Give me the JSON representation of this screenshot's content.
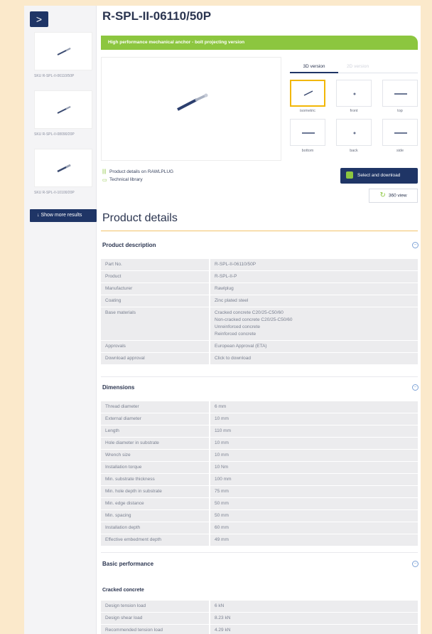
{
  "sidebar": {
    "nav_arrow": ">",
    "items": [
      {
        "sku": "SKU R-SPL-II-06110/50P"
      },
      {
        "sku": "SKU R-SPL-II-08090/20P"
      },
      {
        "sku": "SKU R-SPL-II-10100/20P"
      }
    ],
    "more_label": "Show more results"
  },
  "product": {
    "title": "R-SPL-II-06110/50P",
    "banner": "High performance mechanical anchor - bolt projecting version"
  },
  "viewer": {
    "tabs": [
      "3D version",
      "2D version"
    ],
    "views": [
      {
        "label": "isometric"
      },
      {
        "label": "front"
      },
      {
        "label": "top"
      },
      {
        "label": "bottom"
      },
      {
        "label": "back"
      },
      {
        "label": "side"
      }
    ]
  },
  "links": {
    "details": "Product details on RAWLPLUG",
    "library": "Technical library"
  },
  "actions": {
    "download": "Select and download",
    "view360": "360 view"
  },
  "details_title": "Product details",
  "sections": {
    "description": {
      "title": "Product description",
      "rows": [
        {
          "k": "Part No.",
          "v": "R-SPL-II-06110/50P"
        },
        {
          "k": "Product",
          "v": "R-SPL-II-P"
        },
        {
          "k": "Manufacturer",
          "v": "Rawlplug"
        },
        {
          "k": "Coating",
          "v": "Zinc plated steel"
        },
        {
          "k": "Base materials",
          "v": "Cracked concrete C20/25-C50/60\nNon-cracked concrete C20/25-C50/60\nUnreinforced concrete\nReinforced concrete"
        },
        {
          "k": "Approvals",
          "v": "European Approval (ETA)"
        },
        {
          "k": "Download approval",
          "v": "Click to download"
        }
      ]
    },
    "dimensions": {
      "title": "Dimensions",
      "rows": [
        {
          "k": "Thread diameter",
          "v": "6 mm"
        },
        {
          "k": "External diameter",
          "v": "10 mm"
        },
        {
          "k": "Length",
          "v": "110 mm"
        },
        {
          "k": "Hole diameter in substrate",
          "v": "10 mm"
        },
        {
          "k": "Wrench size",
          "v": "10 mm"
        },
        {
          "k": "Installation torque",
          "v": "10 Nm"
        },
        {
          "k": "Min. substrate thickness",
          "v": "100 mm"
        },
        {
          "k": "Min. hole depth in substrate",
          "v": "75 mm"
        },
        {
          "k": "Min. edge distance",
          "v": "50 mm"
        },
        {
          "k": "Min. spacing",
          "v": "50 mm"
        },
        {
          "k": "Installation depth",
          "v": "60 mm"
        },
        {
          "k": "Effective embedment depth",
          "v": "49 mm"
        }
      ]
    },
    "performance": {
      "title": "Basic performance",
      "subtitle": "Cracked concrete",
      "rows": [
        {
          "k": "Design tension load",
          "v": "6 kN"
        },
        {
          "k": "Design shear load",
          "v": "8.23 kN"
        },
        {
          "k": "Recommended tension load",
          "v": "4.29 kN"
        }
      ]
    }
  },
  "colors": {
    "navy": "#1f3566",
    "green": "#8cc63f",
    "page_bg": "#fbe9cb",
    "selected_border": "#f2b705"
  }
}
